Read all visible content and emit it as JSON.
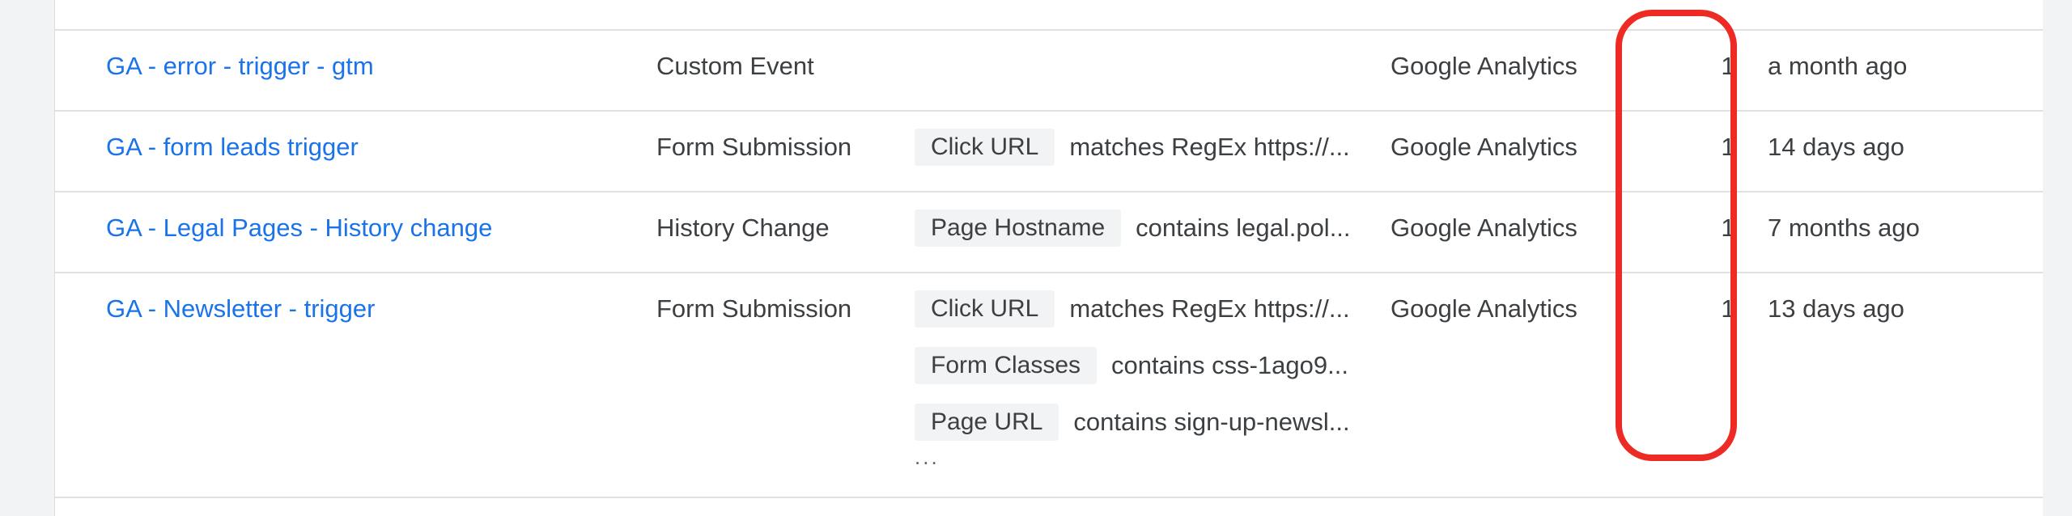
{
  "table": {
    "rows": [
      {
        "name": "",
        "event_type": "",
        "conditions": [],
        "more": "",
        "source": "",
        "tags": "",
        "last_edited": ""
      },
      {
        "name": "GA - error - trigger - gtm",
        "event_type": "Custom Event",
        "conditions": [],
        "more": "",
        "source": "Google Analytics",
        "tags": "1",
        "last_edited": "a month ago"
      },
      {
        "name": "GA - form leads trigger",
        "event_type": "Form Submission",
        "conditions": [
          {
            "variable": "Click URL",
            "text": "matches RegEx https://..."
          }
        ],
        "more": "",
        "source": "Google Analytics",
        "tags": "1",
        "last_edited": "14 days ago"
      },
      {
        "name": "GA - Legal Pages - History change",
        "event_type": "History Change",
        "conditions": [
          {
            "variable": "Page Hostname",
            "text": "contains legal.pol..."
          }
        ],
        "more": "",
        "source": "Google Analytics",
        "tags": "1",
        "last_edited": "7 months ago"
      },
      {
        "name": "GA - Newsletter - trigger",
        "event_type": "Form Submission",
        "conditions": [
          {
            "variable": "Click URL",
            "text": "matches RegEx https://..."
          },
          {
            "variable": "Form Classes",
            "text": "contains css-1ago9..."
          },
          {
            "variable": "Page URL",
            "text": "contains sign-up-newsl..."
          }
        ],
        "more": "...",
        "source": "Google Analytics",
        "tags": "1",
        "last_edited": "13 days ago"
      }
    ]
  },
  "annotation": {
    "color": "#ee2a24"
  }
}
